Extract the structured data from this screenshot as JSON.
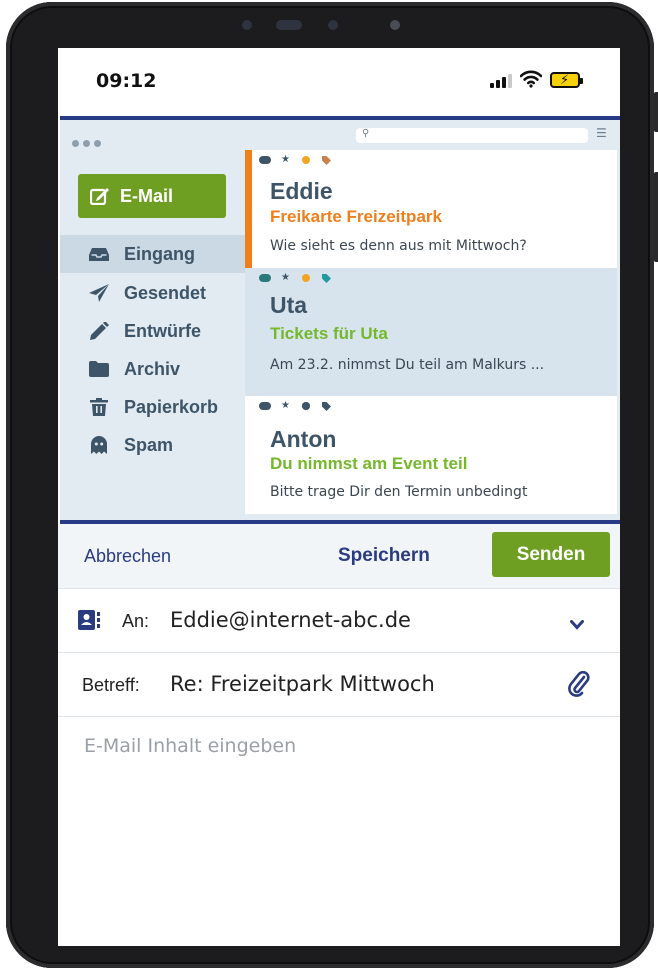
{
  "status_bar": {
    "time": "09:12"
  },
  "sidebar": {
    "compose_label": "E-Mail",
    "folders": [
      {
        "label": "Eingang",
        "icon": "inbox-tray-icon",
        "active": true
      },
      {
        "label": "Gesendet",
        "icon": "paper-plane-icon",
        "active": false
      },
      {
        "label": "Entwürfe",
        "icon": "pencil-icon",
        "active": false
      },
      {
        "label": "Archiv",
        "icon": "folder-icon",
        "active": false
      },
      {
        "label": "Papierkorb",
        "icon": "trash-icon",
        "active": false
      },
      {
        "label": "Spam",
        "icon": "ghost-icon",
        "active": false
      }
    ]
  },
  "mails": [
    {
      "sender": "Eddie",
      "subject": "Freikarte Freizeitpark",
      "preview": "Wie sieht es denn aus mit Mittwoch?",
      "selected": true,
      "subject_color": "#ee7f1b"
    },
    {
      "sender": "Uta",
      "subject": "Tickets für Uta",
      "preview": "Am 23.2. nimmst Du teil am Malkurs ...",
      "selected": false,
      "subject_color": "#75b82c"
    },
    {
      "sender": "Anton",
      "subject": "Du nimmst am Event teil",
      "preview": "Bitte trage Dir den Termin unbedingt",
      "selected": false,
      "subject_color": "#75b82c"
    }
  ],
  "compose": {
    "cancel_label": "Abbrechen",
    "save_label": "Speichern",
    "send_label": "Senden",
    "to_label": "An:",
    "to_value": "Eddie@internet-abc.de",
    "subject_label": "Betreff:",
    "subject_value": "Re: Freizeitpark Mittwoch",
    "body_placeholder": "E-Mail Inhalt eingeben"
  },
  "colors": {
    "accent_green": "#6e9f22",
    "navy": "#263a86",
    "sidebar_bg": "#e2ebf2",
    "selected_strip": "#ee7f1b"
  }
}
